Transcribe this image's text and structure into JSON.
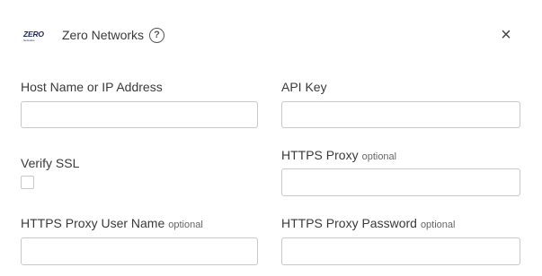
{
  "header": {
    "logo_text": "ZERO",
    "logo_subtext": "Networks",
    "title": "Zero Networks",
    "help_icon": "help-circle-icon",
    "close_icon": "close-icon",
    "close_glyph": "×",
    "help_glyph": "?"
  },
  "form": {
    "host": {
      "label": "Host Name or IP Address",
      "value": "",
      "placeholder": ""
    },
    "api_key": {
      "label": "API Key",
      "value": "",
      "placeholder": ""
    },
    "verify_ssl": {
      "label": "Verify SSL",
      "checked": false
    },
    "https_proxy": {
      "label": "HTTPS Proxy",
      "optional": "optional",
      "value": "",
      "placeholder": ""
    },
    "proxy_user": {
      "label": "HTTPS Proxy User Name",
      "optional": "optional",
      "value": "",
      "placeholder": ""
    },
    "proxy_password": {
      "label": "HTTPS Proxy Password",
      "optional": "optional",
      "value": "",
      "placeholder": ""
    }
  }
}
